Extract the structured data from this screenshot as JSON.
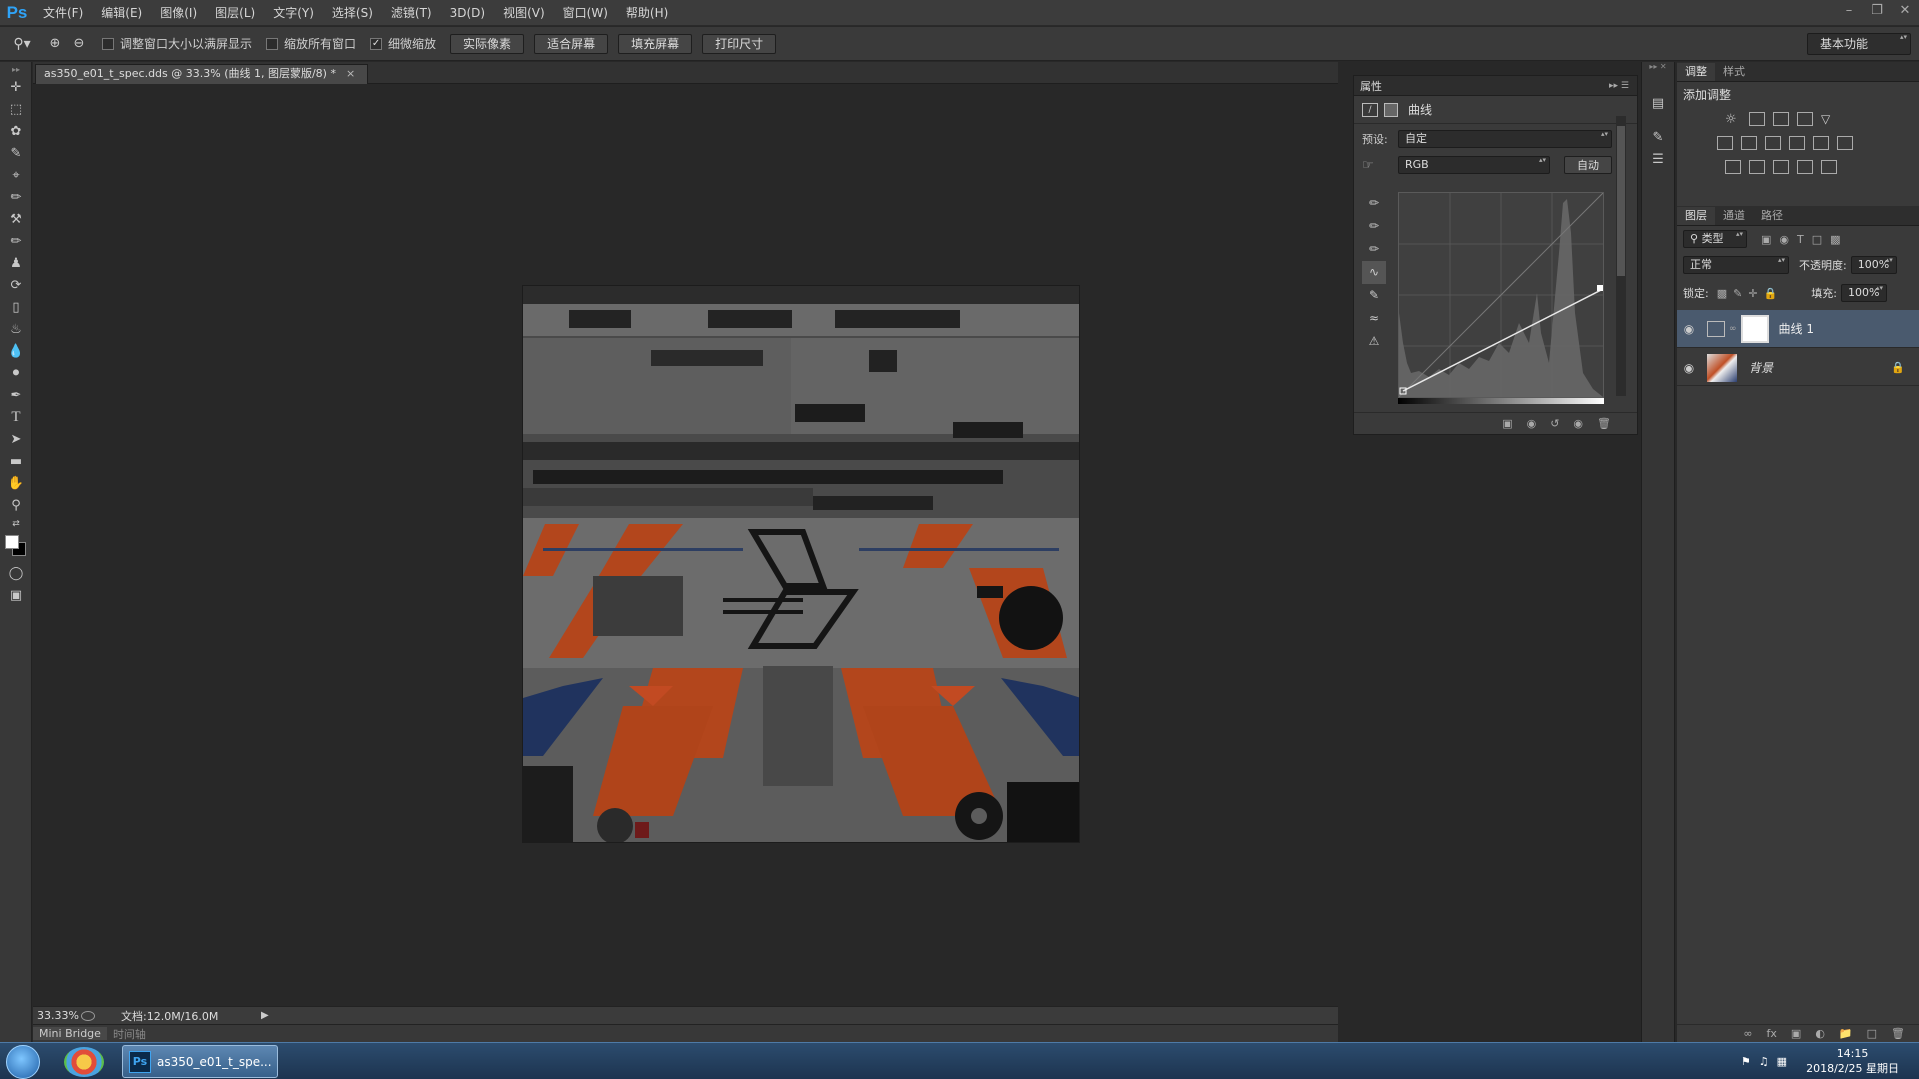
{
  "app": {
    "logo": "Ps"
  },
  "menu": [
    "文件(F)",
    "编辑(E)",
    "图像(I)",
    "图层(L)",
    "文字(Y)",
    "选择(S)",
    "滤镜(T)",
    "3D(D)",
    "视图(V)",
    "窗口(W)",
    "帮助(H)"
  ],
  "options": {
    "check1": "调整窗口大小以满屏显示",
    "check2": "缩放所有窗口",
    "check3": "细微缩放",
    "btn_actual": "实际像素",
    "btn_fit": "适合屏幕",
    "btn_fill": "填充屏幕",
    "btn_print": "打印尺寸",
    "workspace": "基本功能"
  },
  "document": {
    "tab_title": "as350_e01_t_spec.dds @ 33.3% (曲线 1, 图层蒙版/8) *"
  },
  "status": {
    "zoom": "33.33%",
    "doc_size": "文档:12.0M/16.0M"
  },
  "bottom_tabs": [
    "Mini Bridge",
    "时间轴"
  ],
  "properties": {
    "title": "属性",
    "panel_name": "曲线",
    "preset_label": "预设:",
    "preset_value": "自定",
    "channel": "RGB",
    "auto_btn": "自动"
  },
  "adjustments": {
    "tab1": "调整",
    "tab2": "样式",
    "title": "添加调整"
  },
  "layers": {
    "tabs": [
      "图层",
      "通道",
      "路径"
    ],
    "filter": "类型",
    "blend_mode": "正常",
    "opacity_label": "不透明度:",
    "opacity_value": "100%",
    "lock_label": "锁定:",
    "fill_label": "填充:",
    "fill_value": "100%",
    "items": [
      {
        "name": "曲线 1",
        "selected": true
      },
      {
        "name": "背景",
        "selected": false
      }
    ]
  },
  "taskbar": {
    "task_label": "as350_e01_t_spe...",
    "time": "14:15",
    "date": "2018/2/25 星期日"
  }
}
